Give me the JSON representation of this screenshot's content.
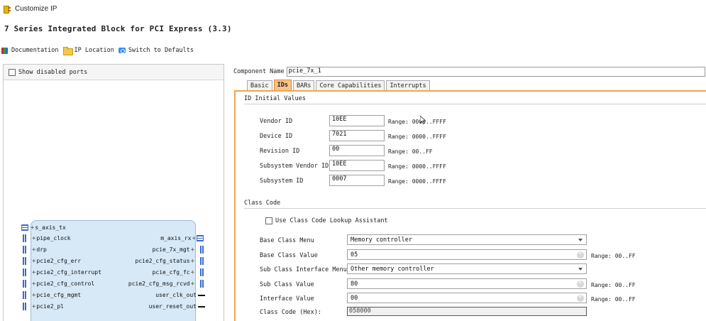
{
  "window": {
    "title": "Customize IP"
  },
  "heading": "7 Series Integrated Block for PCI Express (3.3)",
  "toolbar": {
    "documentation": "Documentation",
    "ip_location": "IP Location",
    "switch_defaults": "Switch to Defaults"
  },
  "left": {
    "show_disabled_ports": "Show disabled ports",
    "block": {
      "left_ports": [
        "s_axis_tx",
        "pipe_clock",
        "drp",
        "pcie2_cfg_err",
        "pcie2_cfg_interrupt",
        "pcie2_cfg_control",
        "pcie_cfg_mgmt",
        "pcie2_pl"
      ],
      "right_ports": [
        "m_axis_rx",
        "pcie_7x_mgt",
        "pcie2_cfg_status",
        "pcie_cfg_fc",
        "pcie2_cfg_msg_rcvd",
        "user_clk_out",
        "user_reset_out"
      ]
    }
  },
  "right": {
    "component_name_label": "Component Name",
    "component_name_value": "pcie_7x_1",
    "tabs": [
      "Basic",
      "IDs",
      "BARs",
      "Core Capabilities",
      "Interrupts"
    ],
    "active_tab": "IDs",
    "id_section": "ID Initial Values",
    "ids": [
      {
        "label": "Vendor ID",
        "value": "10EE",
        "range": "Range: 0000..FFFF"
      },
      {
        "label": "Device ID",
        "value": "7021",
        "range": "Range: 0000..FFFF"
      },
      {
        "label": "Revision ID",
        "value": "00",
        "range": "Range: 00..FF"
      },
      {
        "label": "Subsystem Vendor ID",
        "value": "10EE",
        "range": "Range: 0000..FFFF"
      },
      {
        "label": "Subsystem ID",
        "value": "0007",
        "range": "Range: 0000..FFFF"
      }
    ],
    "class_section": "Class Code",
    "use_lookup": "Use Class Code Lookup Assistant",
    "base_class_menu_label": "Base Class Menu",
    "base_class_menu_value": "Memory controller",
    "base_class_value_label": "Base Class Value",
    "base_class_value": "05",
    "base_class_range": "Range: 00..FF",
    "sub_class_menu_label": "Sub Class Interface Menu",
    "sub_class_menu_value": "Other memory controller",
    "sub_class_value_label": "Sub Class Value",
    "sub_class_value": "80",
    "sub_class_range": "Range: 00..FF",
    "interface_value_label": "Interface Value",
    "interface_value": "00",
    "interface_range": "Range: 00..FF",
    "class_code_hex_label": "Class Code (Hex):",
    "class_code_hex_value": "058000"
  },
  "colors": {
    "active_tab": "#f7c48a",
    "tab_border": "#f0a54c",
    "block_fill": "#d7e8f6",
    "pin": "#3a6cc9"
  }
}
